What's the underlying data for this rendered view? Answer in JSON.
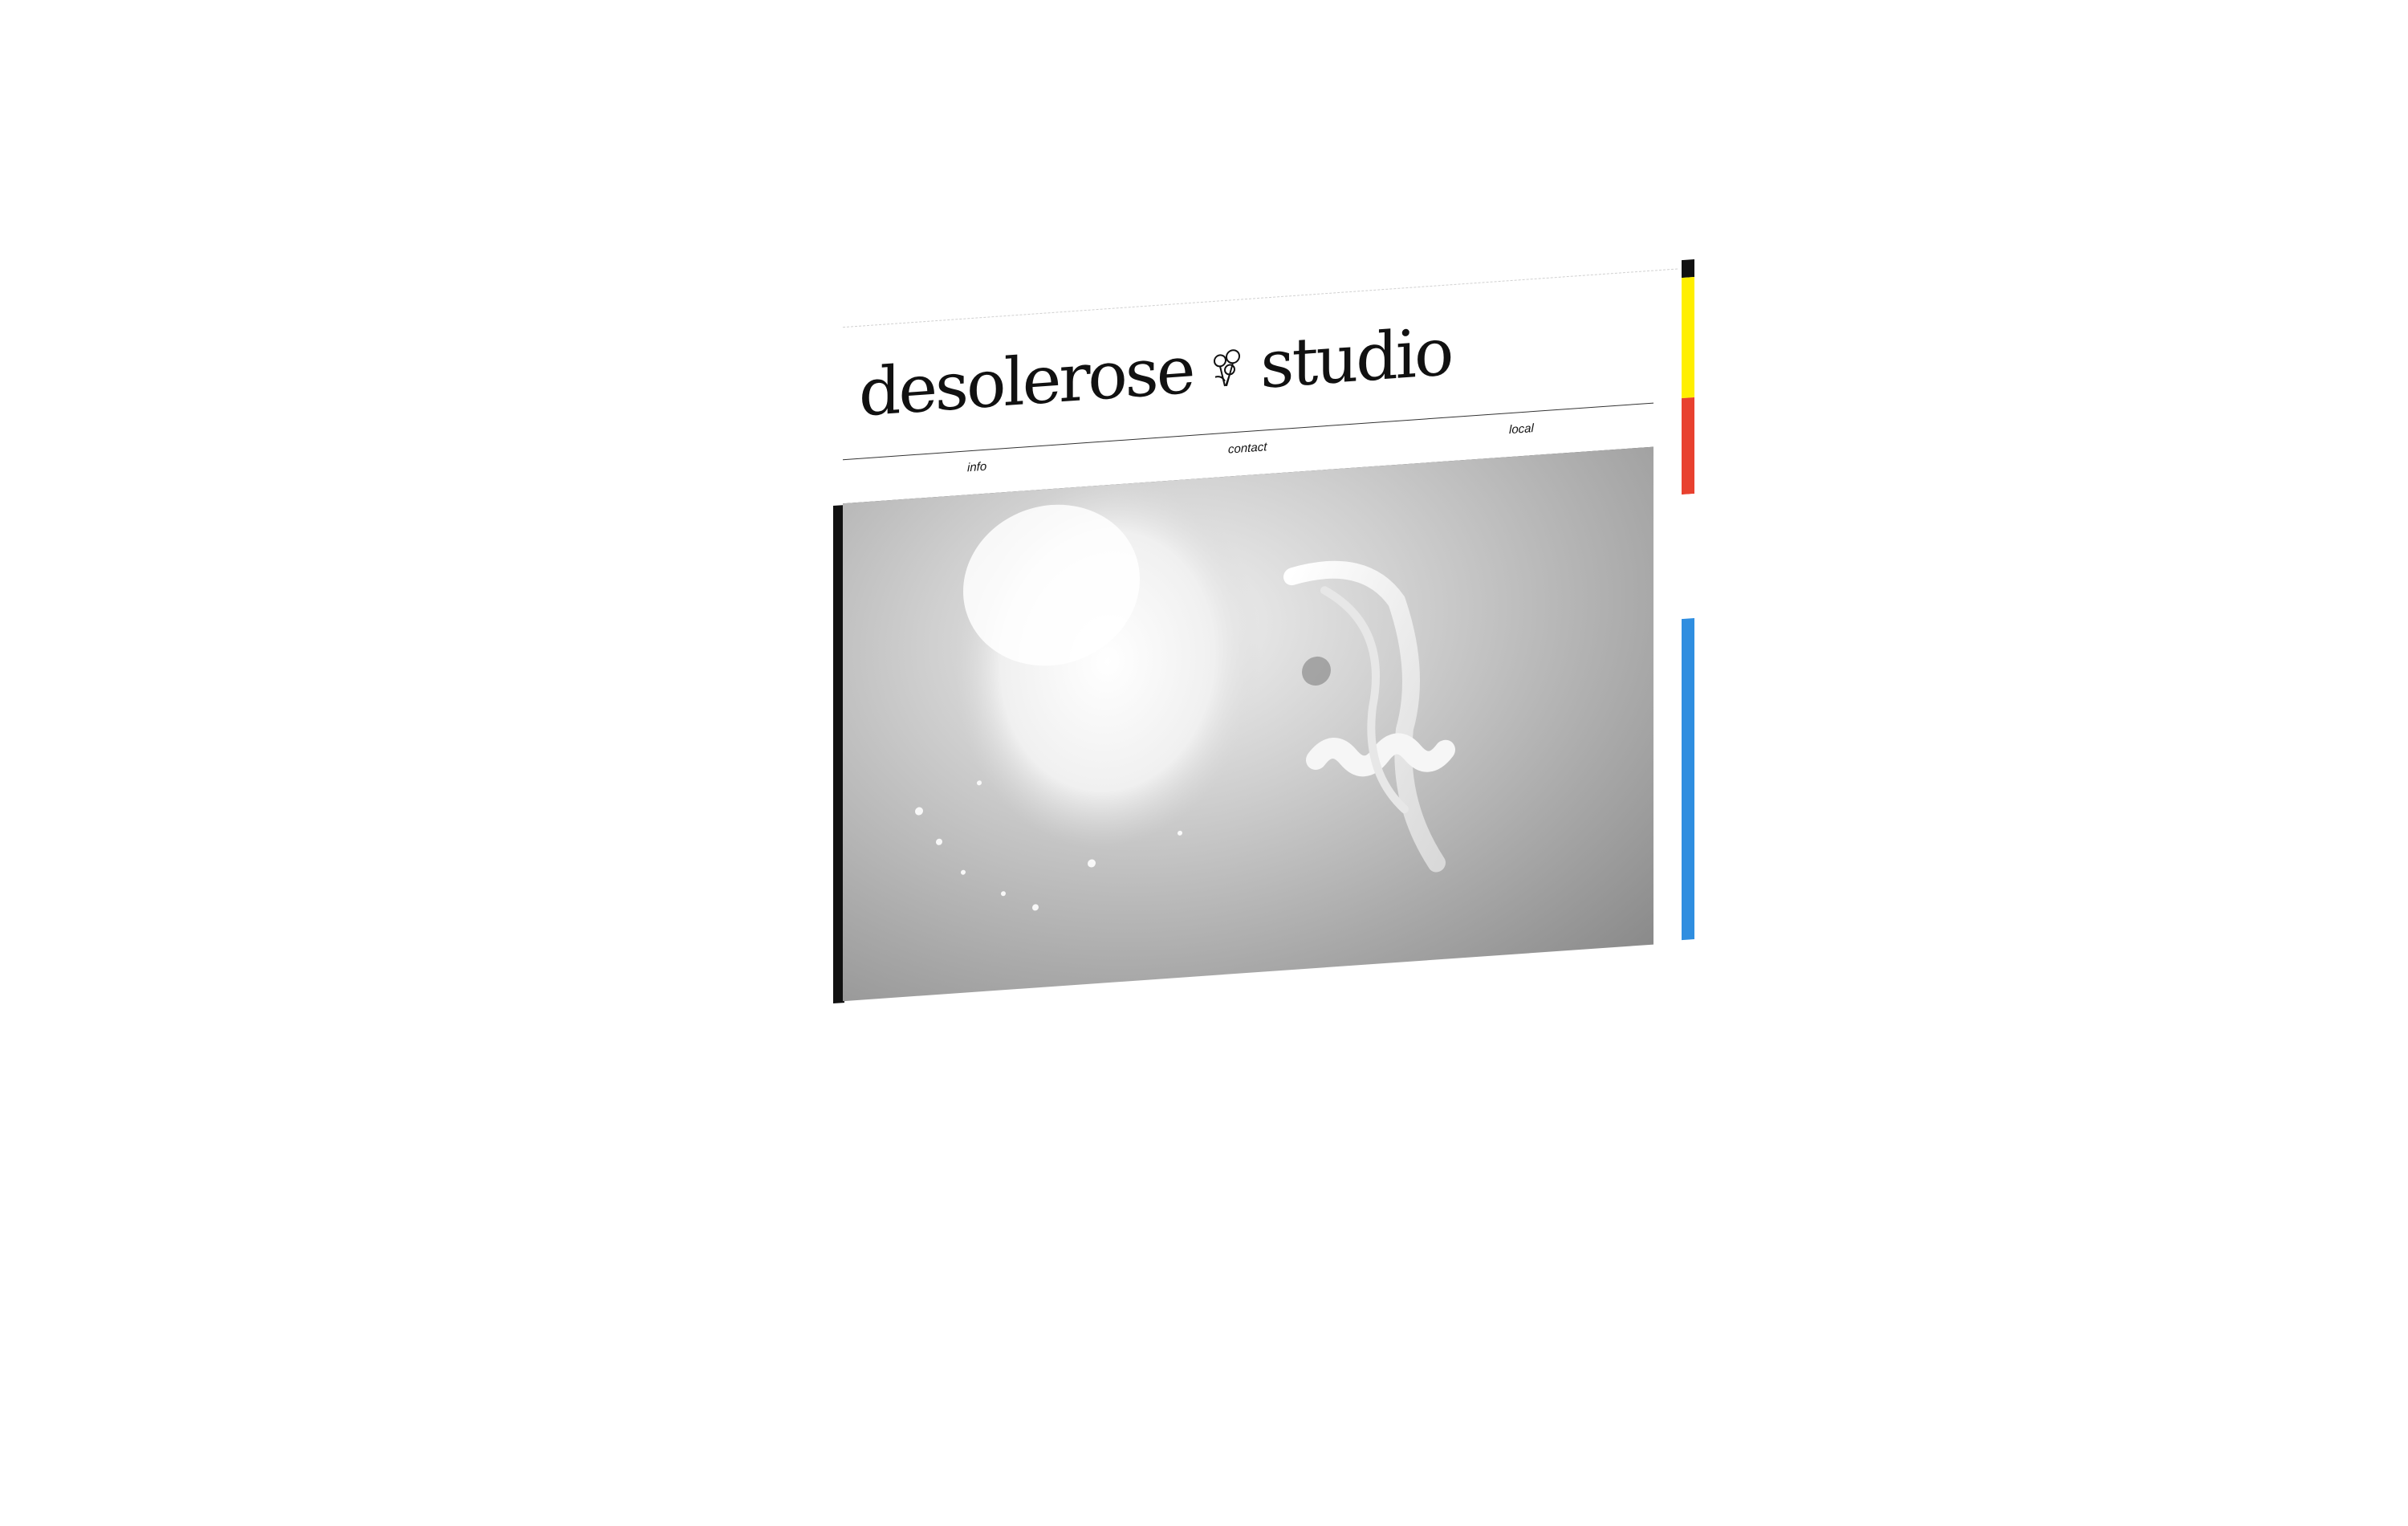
{
  "site": {
    "logo": {
      "left_word": "desolerose",
      "right_word": "studio",
      "flower_icon": "flower-icon"
    },
    "nav": {
      "items": [
        "info",
        "contact",
        "local"
      ]
    },
    "hero": {
      "image_label": ""
    },
    "accent_colors": {
      "black": "#111111",
      "yellow": "#ffef00",
      "red": "#e8412f",
      "blue": "#2f8ee0"
    }
  }
}
